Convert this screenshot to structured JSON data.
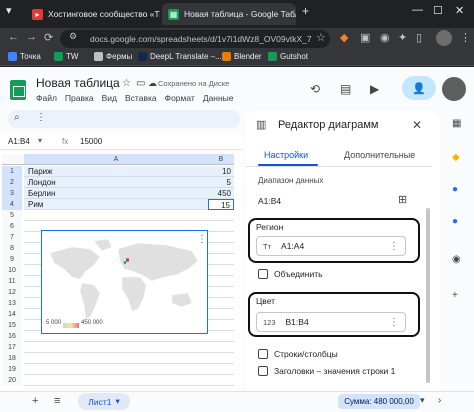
{
  "browser": {
    "tabs": [
      {
        "title": "Хостинговое сообщество «Ti",
        "active": false
      },
      {
        "title": "Новая таблица - Google Табл",
        "active": true
      }
    ],
    "new_tab": "+",
    "url": "docs.google.com/spreadsheets/d/1v7i1dWz8_OV09vtkX_7",
    "bookmarks": [
      "Точка",
      "TW",
      "Фермы",
      "DeepL Translate –...",
      "Blender",
      "Gutshot"
    ]
  },
  "sheets": {
    "doc_title": "Новая таблица",
    "save_status": "Сохранено на Диске",
    "menu": [
      "Файл",
      "Правка",
      "Вид",
      "Вставка",
      "Формат",
      "Данные"
    ],
    "name_box": "A1:B4",
    "fx": "fx",
    "formula_value": "15000",
    "columns": [
      "A",
      "B"
    ],
    "rows": [
      {
        "num": "1",
        "a": "Париж",
        "b": "10"
      },
      {
        "num": "2",
        "a": "Лондон",
        "b": "5"
      },
      {
        "num": "3",
        "a": "Берлин",
        "b": "450"
      },
      {
        "num": "4",
        "a": "Рим",
        "b": "15"
      },
      {
        "num": "5",
        "a": "",
        "b": ""
      },
      {
        "num": "6",
        "a": "",
        "b": ""
      },
      {
        "num": "7",
        "a": "",
        "b": ""
      },
      {
        "num": "8",
        "a": "",
        "b": ""
      },
      {
        "num": "9",
        "a": "",
        "b": ""
      },
      {
        "num": "10",
        "a": "",
        "b": ""
      },
      {
        "num": "11",
        "a": "",
        "b": ""
      },
      {
        "num": "12",
        "a": "",
        "b": ""
      },
      {
        "num": "13",
        "a": "",
        "b": ""
      },
      {
        "num": "14",
        "a": "",
        "b": ""
      },
      {
        "num": "15",
        "a": "",
        "b": ""
      },
      {
        "num": "16",
        "a": "",
        "b": ""
      },
      {
        "num": "17",
        "a": "",
        "b": ""
      },
      {
        "num": "18",
        "a": "",
        "b": ""
      },
      {
        "num": "19",
        "a": "",
        "b": ""
      },
      {
        "num": "20",
        "a": "",
        "b": ""
      }
    ],
    "chart": {
      "legend_min": "5 000",
      "legend_max": "450 000"
    },
    "sheet_tab": "Лист1",
    "sum": "Сумма: 480 000,00"
  },
  "editor": {
    "title": "Редактор диаграмм",
    "tab_setup": "Настройки",
    "tab_customize": "Дополнительные",
    "range_label": "Диапазон данных",
    "range_value": "A1:B4",
    "region_label": "Регион",
    "region_value": "A1:A4",
    "region_icon": "Tт",
    "merge_label": "Объединить",
    "color_label": "Цвет",
    "color_value": "B1:B4",
    "color_icon": "123",
    "switch_rows_label": "Строки/столбцы",
    "headers_label": "Заголовки – значения строки 1"
  },
  "colors": {
    "accent": "#0b57d0",
    "sheets_green": "#0f9d58",
    "highlight_border": "#111111"
  }
}
